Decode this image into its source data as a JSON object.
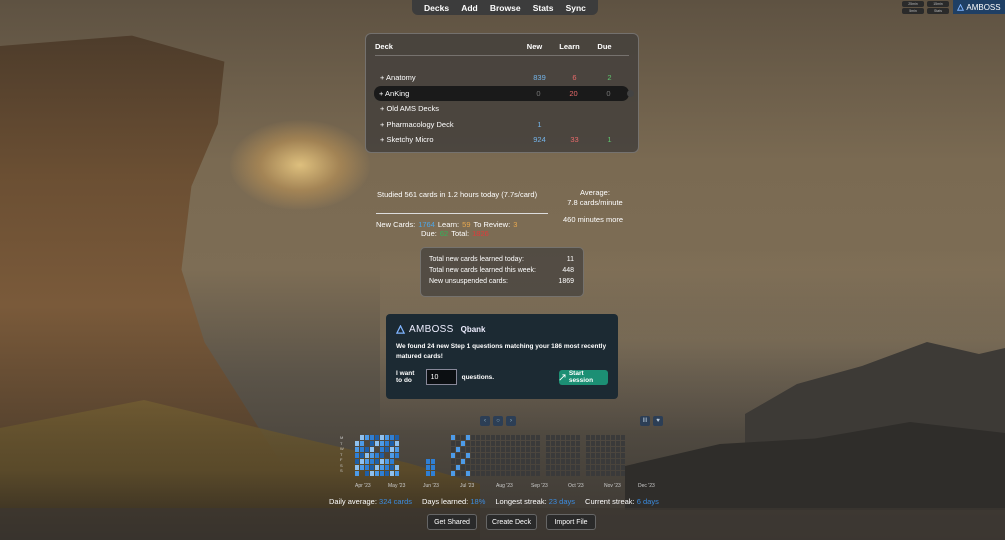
{
  "toolbar": {
    "decks": "Decks",
    "add": "Add",
    "browse": "Browse",
    "stats": "Stats",
    "sync": "Sync"
  },
  "top_right": {
    "mini_buttons": [
      "25min",
      "15min",
      "5min",
      "Stats"
    ],
    "amboss_label": "AMBOSS",
    "icon": "amboss-logo-icon"
  },
  "deck_table": {
    "headers": {
      "deck": "Deck",
      "new": "New",
      "learn": "Learn",
      "due": "Due"
    },
    "rows": [
      {
        "name": "+ Anatomy",
        "new": "839",
        "learn": "6",
        "due": "2",
        "selected": false
      },
      {
        "name": "+ AnKing",
        "new": "0",
        "learn": "20",
        "due": "0",
        "selected": true
      },
      {
        "name": "+ Old AMS Decks",
        "new": "",
        "learn": "",
        "due": "",
        "selected": false
      },
      {
        "name": "+ Pharmacology Deck",
        "new": "1",
        "learn": "",
        "due": "",
        "selected": false
      },
      {
        "name": "+ Sketchy Micro",
        "new": "924",
        "learn": "33",
        "due": "1",
        "selected": false
      }
    ],
    "colors": {
      "new": "#74b4e8",
      "learn": "#e86a6a",
      "due": "#5ec56e"
    }
  },
  "study": {
    "studied_text": "Studied 561 cards in 1.2 hours today (7.7s/card)",
    "average_label": "Average:",
    "average_value": "7.8 cards/minute",
    "minutes_more": "460 minutes more",
    "new_cards_label": "New Cards:",
    "new_cards_value": "1764",
    "learn_label": "Learn:",
    "learn_value": "59",
    "to_review_label": "To Review:",
    "to_review_value": "3",
    "due_label": "Due:",
    "due_value": "62",
    "total_label": "Total:",
    "total_value": "1826"
  },
  "totals": [
    {
      "label": "Total new cards learned today:",
      "value": "11"
    },
    {
      "label": "Total new cards learned this week:",
      "value": "448"
    },
    {
      "label": "New unsuspended cards:",
      "value": "1869"
    }
  ],
  "qbank": {
    "brand": "AMBOSS",
    "product": "Qbank",
    "message": "We found 24 new Step 1 questions matching your 186 most recently matured cards!",
    "want_label": "I want to do",
    "input_value": "10",
    "questions_label": "questions.",
    "start_label": "Start session",
    "accent": "#1c8f74"
  },
  "heatmap": {
    "weekday_labels": [
      "M",
      "T",
      "W",
      "T",
      "F",
      "S",
      "S"
    ],
    "months": [
      "Apr '23",
      "May '23",
      "Jun '23",
      "Jul '23",
      "Aug '23",
      "Sep '23",
      "Oct '23",
      "Nov '23",
      "Dec '23"
    ],
    "nav": [
      "‹",
      "○",
      "›"
    ],
    "controls": [
      "III",
      "♥"
    ]
  },
  "footer_stats": {
    "daily_average_label": "Daily average:",
    "daily_average_value": "324 cards",
    "days_learned_label": "Days learned:",
    "days_learned_value": "18%",
    "longest_streak_label": "Longest streak:",
    "longest_streak_value": "23 days",
    "current_streak_label": "Current streak:",
    "current_streak_value": "6 days"
  },
  "bottom_buttons": {
    "get_shared": "Get Shared",
    "create_deck": "Create Deck",
    "import_file": "Import File"
  }
}
